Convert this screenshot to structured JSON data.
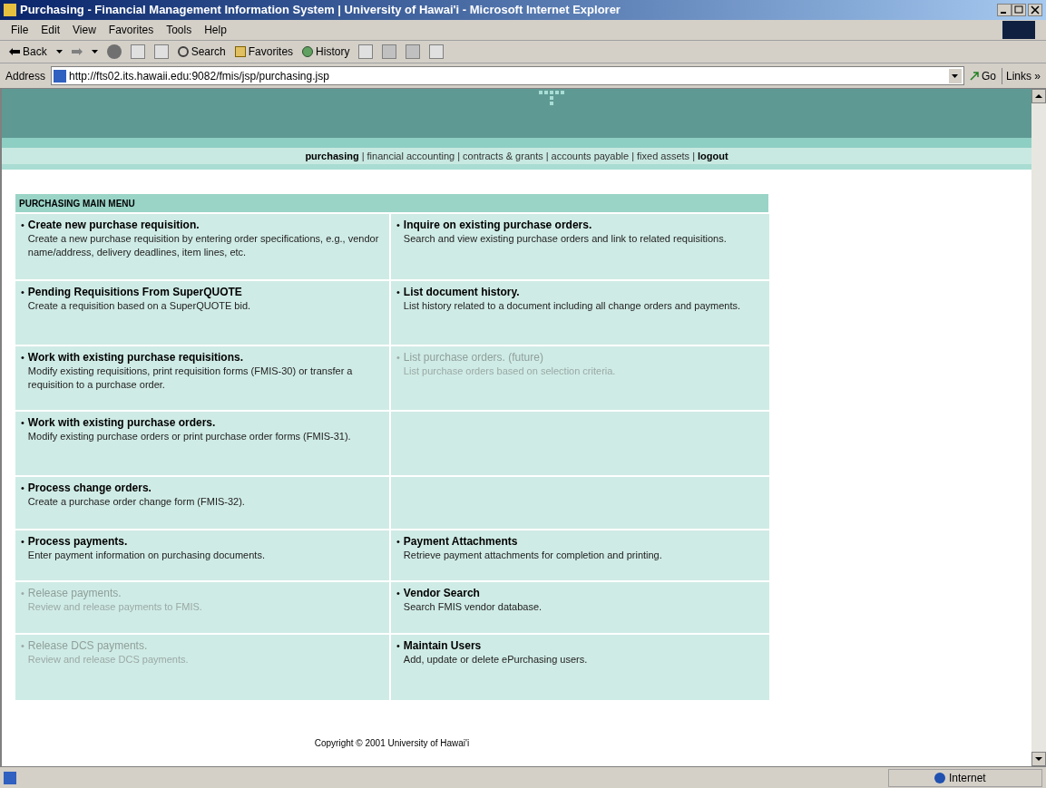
{
  "window": {
    "title": "Purchasing - Financial Management Information System | University of Hawai'i - Microsoft Internet Explorer"
  },
  "menu": [
    "File",
    "Edit",
    "View",
    "Favorites",
    "Tools",
    "Help"
  ],
  "toolbar": {
    "back": "Back",
    "search": "Search",
    "favorites": "Favorites",
    "history": "History"
  },
  "address": {
    "label": "Address",
    "value": "http://fts02.its.hawaii.edu:9082/fmis/jsp/purchasing.jsp",
    "go": "Go",
    "links": "Links »"
  },
  "nav": {
    "separator": "|",
    "items": [
      {
        "label": "purchasing",
        "emphasized": true
      },
      {
        "label": "financial accounting",
        "emphasized": false
      },
      {
        "label": "contracts & grants",
        "emphasized": false
      },
      {
        "label": "accounts payable",
        "emphasized": false
      },
      {
        "label": "fixed assets",
        "emphasized": false
      },
      {
        "label": "logout",
        "emphasized": true
      }
    ]
  },
  "menu_table": {
    "title": "PURCHASING MAIN MENU",
    "bullet": "•",
    "rows": [
      {
        "left": {
          "title": "Create new purchase requisition.",
          "description": "Create a new purchase requisition by entering order specifications, e.g., vendor name/address, delivery deadlines, item lines, etc.",
          "disabled": false
        },
        "right": {
          "title": "Inquire on existing purchase orders.",
          "description": "Search and view existing purchase orders and link to related requisitions.",
          "disabled": false
        }
      },
      {
        "left": {
          "title": "Pending Requisitions From SuperQUOTE",
          "description": "Create a requisition based on a SuperQUOTE bid.",
          "disabled": false
        },
        "right": {
          "title": "List document history.",
          "description": "List history related to a document including all change orders and payments.",
          "disabled": false
        }
      },
      {
        "left": {
          "title": "Work with existing purchase requisitions.",
          "description": "Modify existing requisitions, print requisition forms (FMIS-30) or transfer a requisition to a purchase order.",
          "disabled": false
        },
        "right": {
          "title": "List purchase orders. (future)",
          "description": "List purchase orders based on selection criteria.",
          "disabled": true
        }
      },
      {
        "left": {
          "title": "Work with existing purchase orders.",
          "description": "Modify existing purchase orders or print purchase order forms (FMIS-31).",
          "disabled": false
        }
      },
      {
        "left": {
          "title": "Process change orders.",
          "description": "Create a purchase order change form (FMIS-32).",
          "disabled": false
        }
      },
      {
        "left": {
          "title": "Process payments.",
          "description": "Enter payment information on purchasing documents.",
          "disabled": false
        },
        "right": {
          "title": "Payment Attachments",
          "description": "Retrieve payment attachments for completion and printing.",
          "disabled": false
        }
      },
      {
        "left": {
          "title": "Release payments.",
          "description": "Review and release payments to FMIS.",
          "disabled": true
        },
        "right": {
          "title": "Vendor Search",
          "description": "Search FMIS vendor database.",
          "disabled": false
        }
      },
      {
        "left": {
          "title": "Release DCS payments.",
          "description": "Review and release DCS payments.",
          "disabled": true
        },
        "right": {
          "title": "Maintain Users",
          "description": "Add, update or delete ePurchasing users.",
          "disabled": false
        }
      }
    ]
  },
  "footer": "Copyright © 2001 University of Hawai'i",
  "status_bar": {
    "zone": "Internet"
  }
}
